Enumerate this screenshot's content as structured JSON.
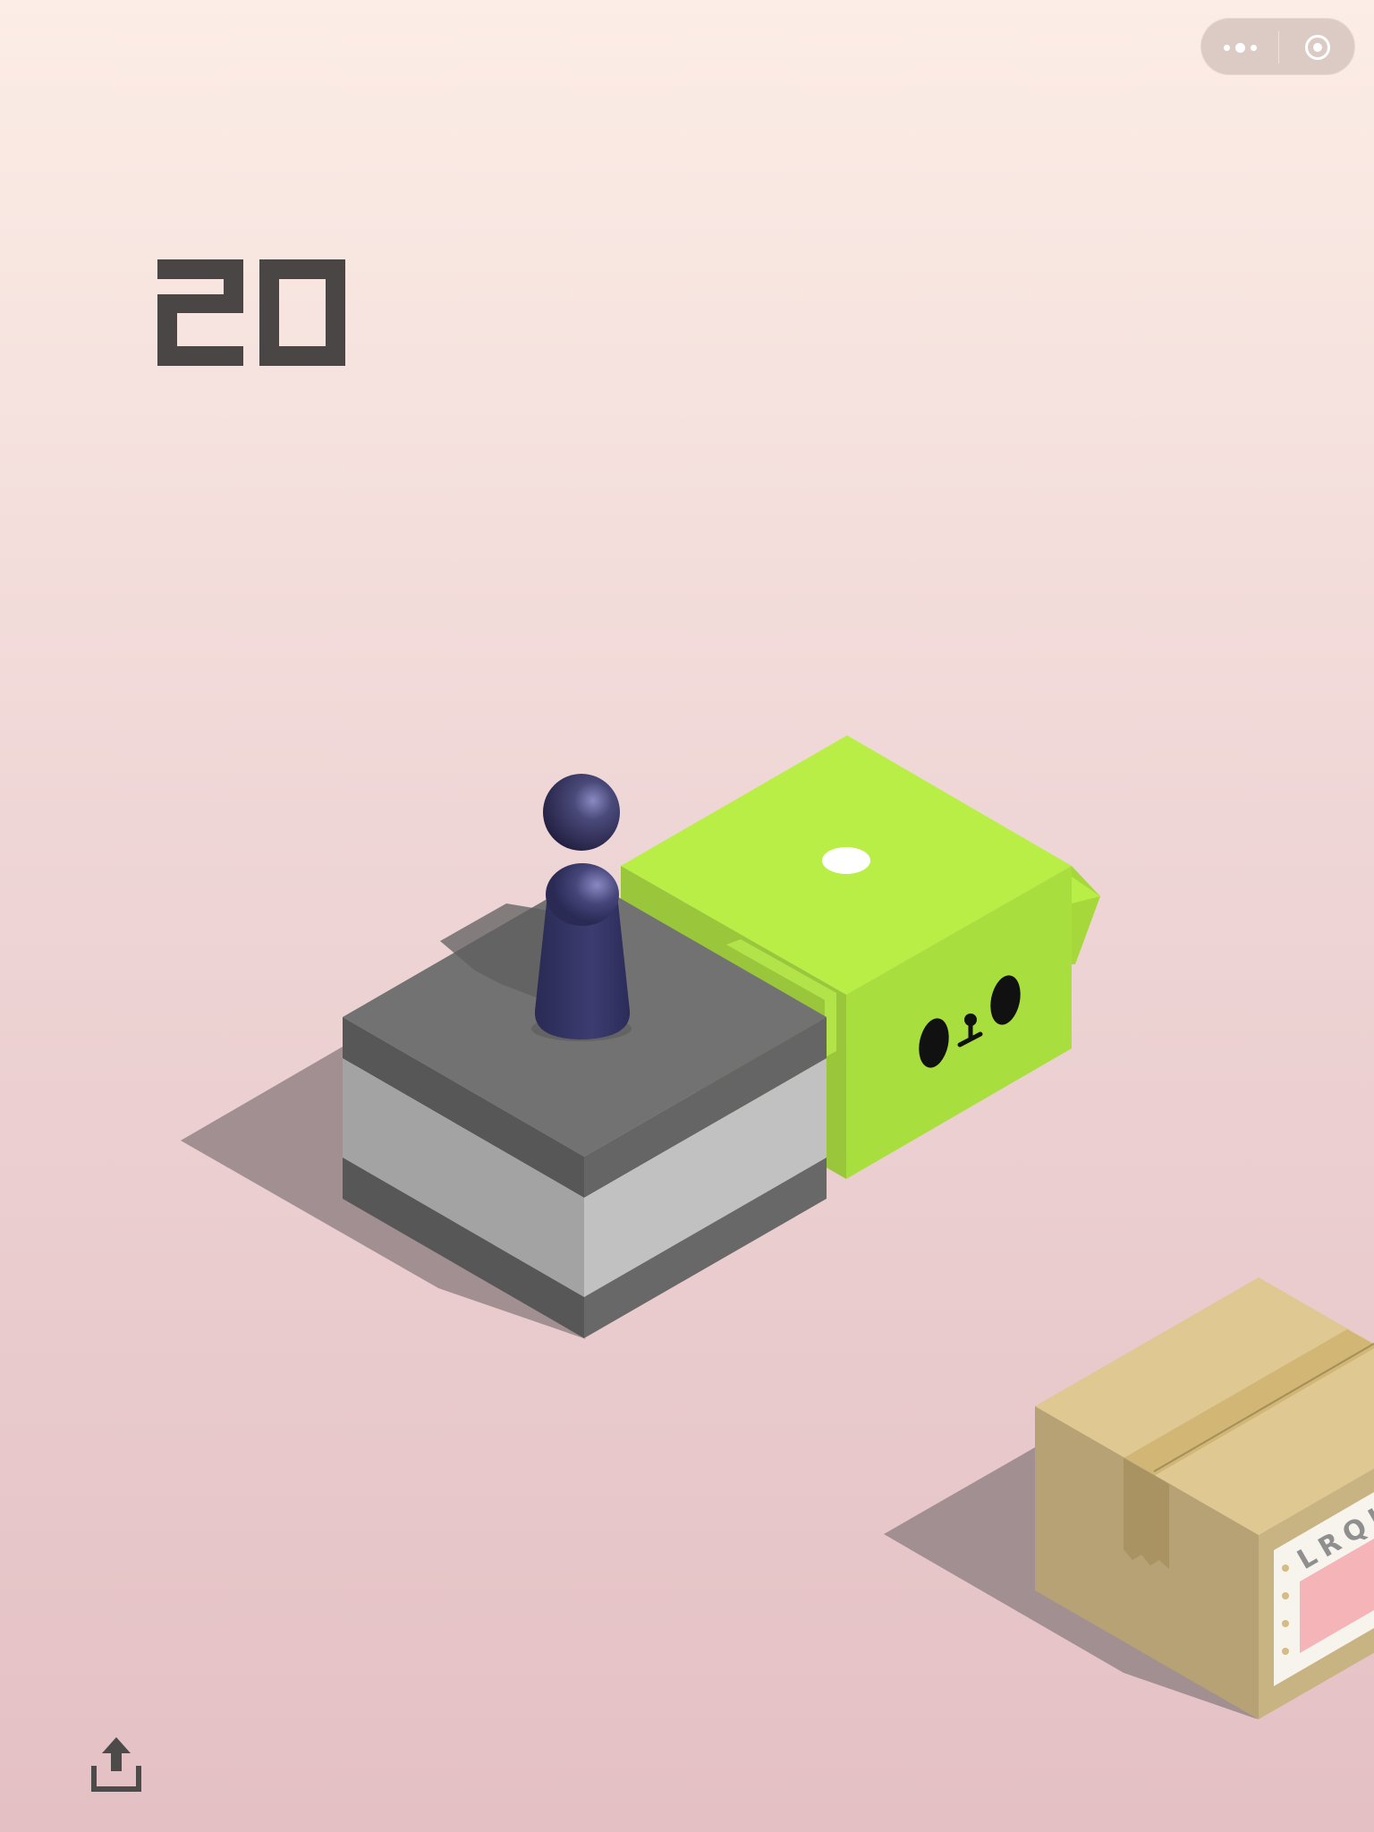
{
  "game": {
    "score": "20"
  },
  "capsule": {
    "more_icon": "more-dots-icon",
    "close_icon": "target-close-icon"
  },
  "share": {
    "icon": "share-upload-icon"
  },
  "package": {
    "label_text": "LRQI"
  },
  "colors": {
    "background_top": "#fcede6",
    "background_bottom": "#e4c0c4",
    "score": "#4a4646",
    "player": "#3a3a6a",
    "gray_block_top": "#727272",
    "green_block_top": "#b8ee46",
    "package_top": "#e0c892"
  }
}
